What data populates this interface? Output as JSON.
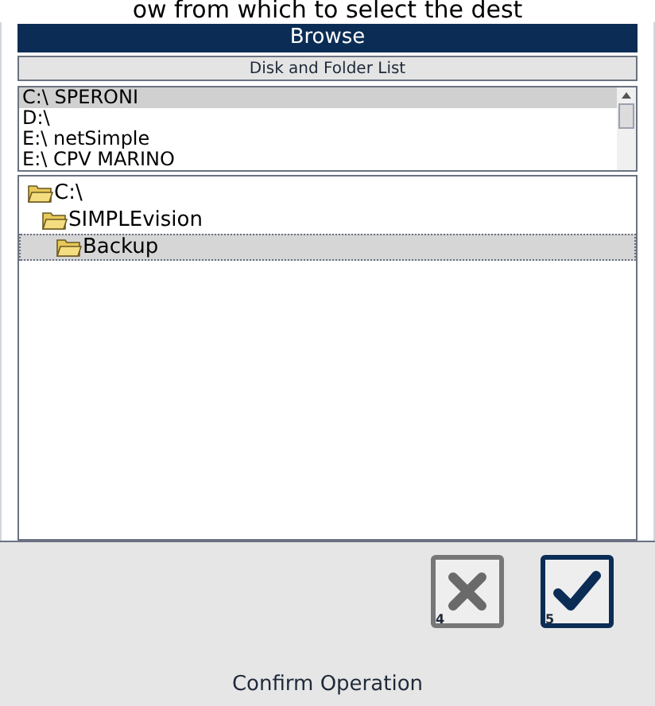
{
  "caption": "ow from which to select the dest",
  "window": {
    "title": "Browse"
  },
  "list_header": "Disk and Folder List",
  "drives": [
    {
      "label": "C:\\ SPERONI",
      "selected": true
    },
    {
      "label": "D:\\",
      "selected": false
    },
    {
      "label": "E:\\ netSimple",
      "selected": false
    },
    {
      "label": "E:\\ CPV MARINO",
      "selected": false
    }
  ],
  "tree": [
    {
      "label": "C:\\",
      "selected": false,
      "children": [
        {
          "label": "SIMPLEvision",
          "selected": false,
          "children": [
            {
              "label": "Backup",
              "selected": true
            }
          ]
        }
      ]
    }
  ],
  "buttons": [
    {
      "kind": "cancel",
      "key": "4"
    },
    {
      "kind": "confirm",
      "key": "5"
    }
  ],
  "footer": "Confirm Operation"
}
